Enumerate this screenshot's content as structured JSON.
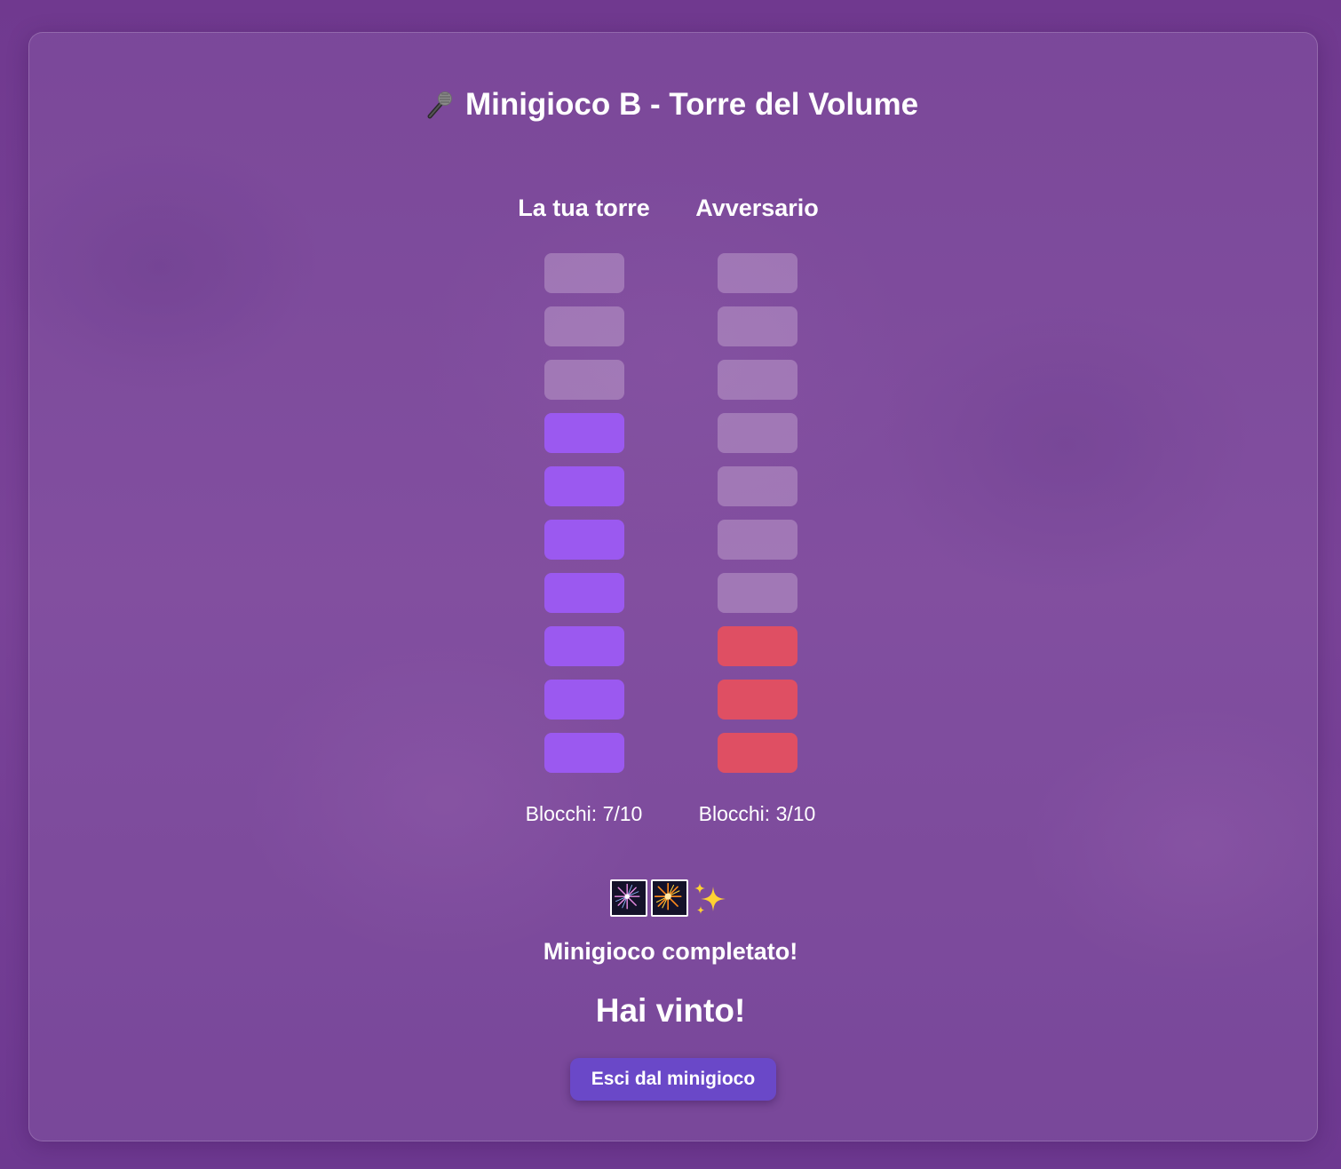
{
  "game": {
    "title": "Minigioco B - Torre del Volume",
    "title_icon": "microphone-icon"
  },
  "towers": [
    {
      "id": "player",
      "heading": "La tua torre",
      "blocks_filled": 7,
      "blocks_total": 10,
      "count_label": "Blocchi: 7/10",
      "fill_color": "#9b59f0"
    },
    {
      "id": "opponent",
      "heading": "Avversario",
      "blocks_filled": 3,
      "blocks_total": 10,
      "count_label": "Blocchi: 3/10",
      "fill_color": "#df4f63"
    }
  ],
  "colors": {
    "empty_block": "rgba(200,170,210,0.45)",
    "button": "#6a48c8",
    "background": "#6e3790"
  },
  "celebration_icons": [
    "fireworks-icon",
    "firework-burst-icon",
    "sparkles-icon"
  ],
  "status": {
    "completed": "Minigioco completato!",
    "result": "Hai vinto!"
  },
  "buttons": {
    "exit_label": "Esci dal minigioco"
  }
}
